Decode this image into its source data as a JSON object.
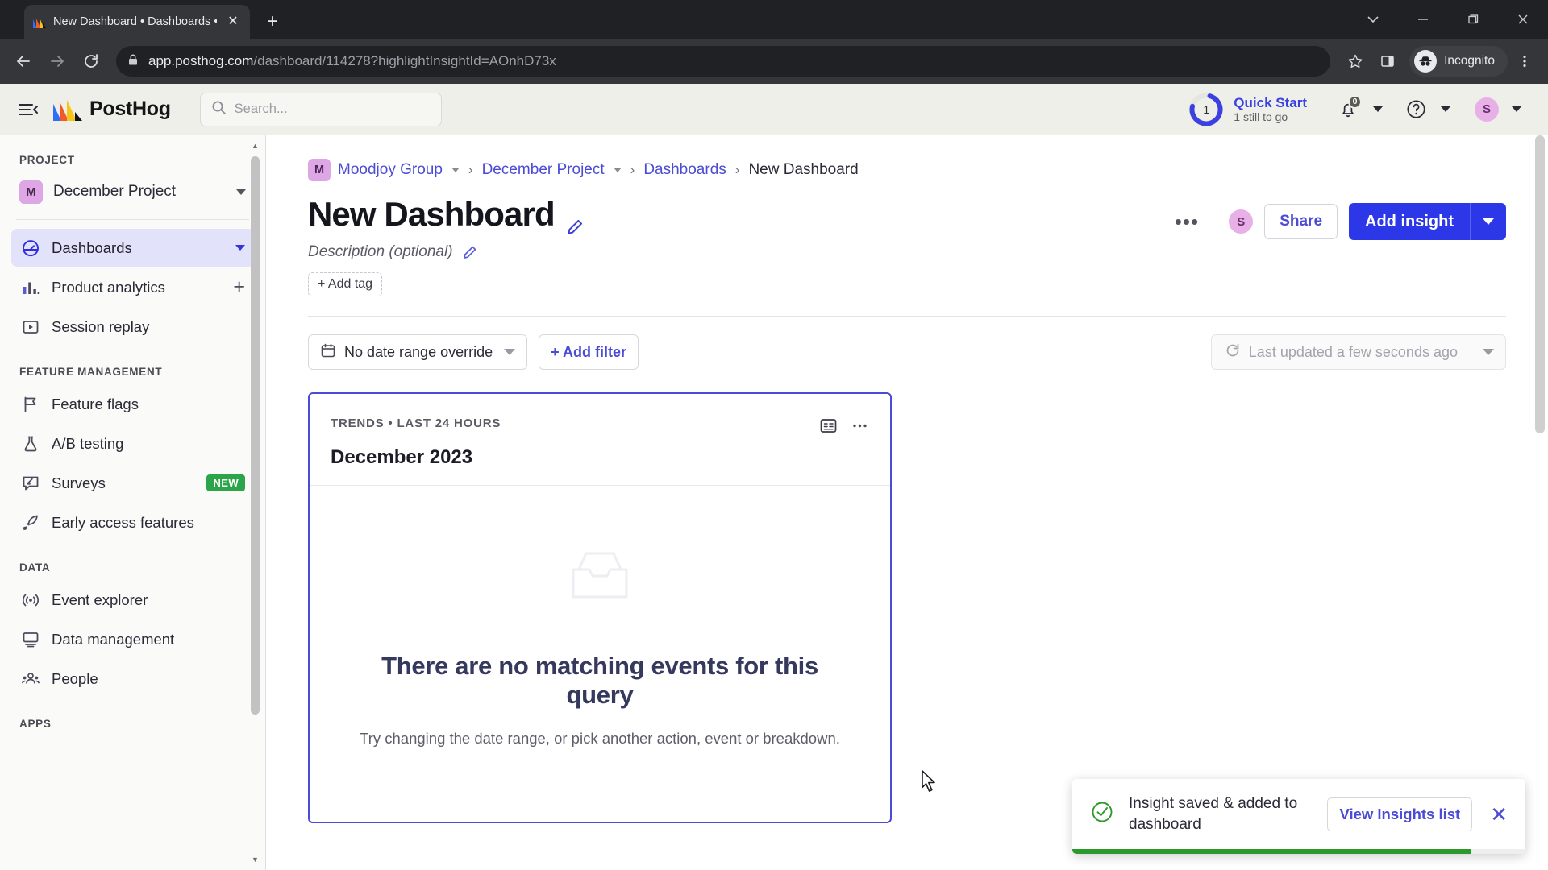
{
  "browser": {
    "tab_title": "New Dashboard • Dashboards •",
    "new_tab_label": "+",
    "close_tab_label": "✕",
    "url_host": "app.posthog.com",
    "url_path": "/dashboard/114278?highlightInsightId=AOnhD73x",
    "profile_label": "Incognito",
    "icons": {
      "back": "back-arrow-icon",
      "forward": "forward-arrow-icon",
      "reload": "reload-icon",
      "lock": "lock-icon",
      "bookmark": "star-icon",
      "sidepanel": "side-panel-icon",
      "menu": "kebab-menu-icon",
      "tab_search": "chevron-down-icon",
      "minimize": "minimize-icon",
      "maximize": "maximize-icon",
      "close": "window-close-icon"
    }
  },
  "topbar": {
    "brand": "PostHog",
    "search_placeholder": "Search...",
    "quick_start": {
      "title": "Quick Start",
      "subtitle": "1 still to go",
      "progress_number": "1",
      "progress_percent": 75,
      "ring_color": "#3a41e0"
    },
    "notifications_count": "0",
    "avatar_initial": "S"
  },
  "sidebar": {
    "sections": [
      {
        "label": "PROJECT",
        "project": {
          "badge": "M",
          "name": "December Project"
        },
        "items": [
          {
            "label": "Dashboards",
            "icon": "dashboard-icon",
            "active": true,
            "trailing": "caret"
          },
          {
            "label": "Product analytics",
            "icon": "bar-chart-icon",
            "active": false,
            "trailing": "plus"
          },
          {
            "label": "Session replay",
            "icon": "play-square-icon",
            "active": false,
            "trailing": ""
          }
        ]
      },
      {
        "label": "FEATURE MANAGEMENT",
        "items": [
          {
            "label": "Feature flags",
            "icon": "flag-icon",
            "active": false,
            "trailing": ""
          },
          {
            "label": "A/B testing",
            "icon": "flask-icon",
            "active": false,
            "trailing": ""
          },
          {
            "label": "Surveys",
            "icon": "survey-icon",
            "active": false,
            "trailing": "badge",
            "badge": "NEW"
          },
          {
            "label": "Early access features",
            "icon": "rocket-icon",
            "active": false,
            "trailing": ""
          }
        ]
      },
      {
        "label": "DATA",
        "items": [
          {
            "label": "Event explorer",
            "icon": "broadcast-icon",
            "active": false,
            "trailing": ""
          },
          {
            "label": "Data management",
            "icon": "monitor-icon",
            "active": false,
            "trailing": ""
          },
          {
            "label": "People",
            "icon": "people-icon",
            "active": false,
            "trailing": ""
          }
        ]
      },
      {
        "label": "APPS",
        "items": []
      }
    ]
  },
  "breadcrumb": {
    "org_badge": "M",
    "items": [
      {
        "label": "Moodjoy Group",
        "link": true,
        "caret": true
      },
      {
        "label": "December Project",
        "link": true,
        "caret": true
      },
      {
        "label": "Dashboards",
        "link": true,
        "caret": false
      },
      {
        "label": "New Dashboard",
        "link": false,
        "caret": false
      }
    ],
    "separator": "›"
  },
  "page": {
    "title": "New Dashboard",
    "description_placeholder": "Description (optional)",
    "add_tag_label": "+ Add tag",
    "actions": {
      "more_label": "•••",
      "avatar_initial": "S",
      "share_label": "Share",
      "add_insight_label": "Add insight"
    }
  },
  "filters": {
    "date_range_label": "No date range override",
    "add_filter_label": "+ Add filter",
    "last_updated_label": "Last updated a few seconds ago"
  },
  "insight_card": {
    "kicker": "TRENDS • LAST 24 HOURS",
    "title": "December 2023",
    "empty_heading": "There are no matching events for this query",
    "empty_subtext": "Try changing the date range, or pick another action, event or breakdown.",
    "border_color": "#4b4bd6"
  },
  "toast": {
    "message": "Insight saved & added to dashboard",
    "action_label": "View Insights list",
    "close_label": "✕",
    "progress_percent": 88,
    "accent_color": "#2b9a2b"
  },
  "chart_data": {
    "type": "line",
    "title": "December 2023",
    "subtitle": "TRENDS • LAST 24 HOURS",
    "categories": [],
    "values": [],
    "series": [],
    "xlabel": "",
    "ylabel": "",
    "empty": true,
    "empty_message": "There are no matching events for this query"
  }
}
